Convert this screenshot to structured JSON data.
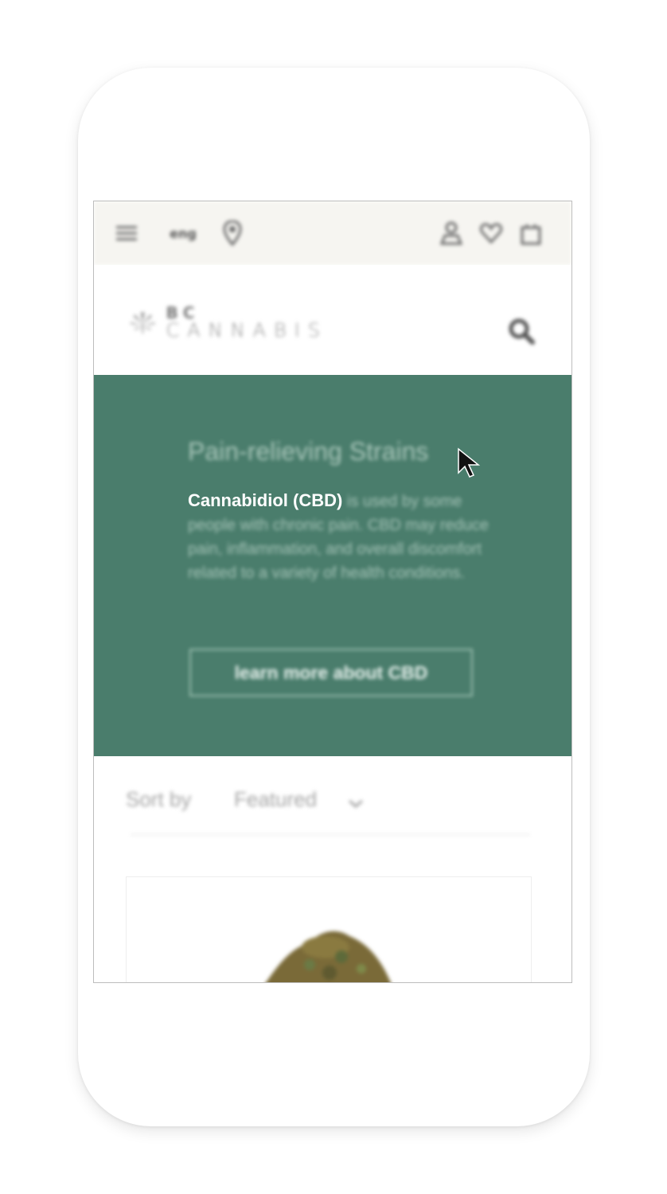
{
  "topbar": {
    "menu_icon": "menu-icon",
    "language_label": "eng",
    "location_icon": "map-pin-icon",
    "account_icon": "account-icon",
    "wishlist_icon": "heart-icon",
    "cart_icon": "shopping-bag-icon",
    "background": "#f6f5f1"
  },
  "header": {
    "logo_line1": "BC",
    "logo_line2": "CANNABIS",
    "search_icon": "search-icon"
  },
  "hero": {
    "background": "#4a7d6c",
    "title": "Pain-relieving Strains",
    "description_strong": "Cannabidiol (CBD)",
    "description_rest": "is used by some people with chronic pain. CBD may reduce pain, inflammation, and overall discomfort related to a variety of health conditions.",
    "cta_label": "learn more about CBD"
  },
  "sort": {
    "label": "Sort by",
    "selected": "Featured"
  },
  "product": {
    "image_icon": "cannabis-bud-image"
  }
}
